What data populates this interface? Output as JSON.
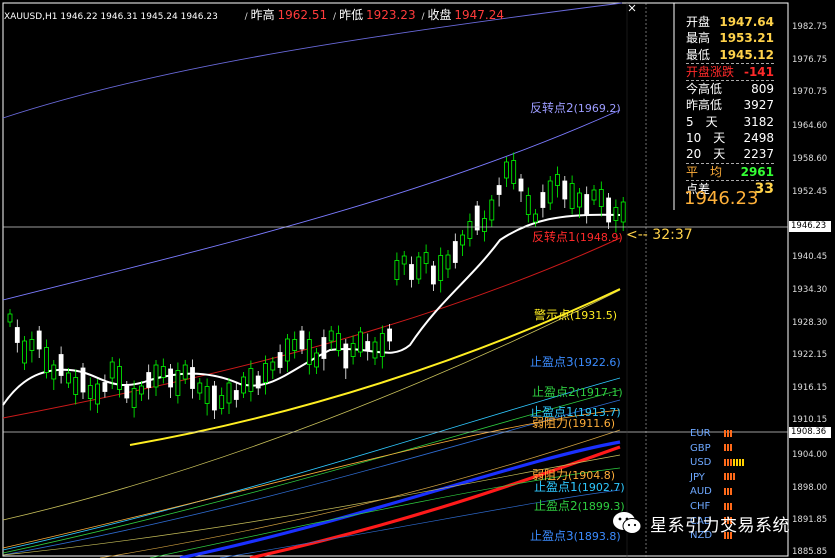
{
  "header": {
    "symbol": "XAUUSD,H1",
    "ohlc": "1946.22 1946.31 1945.24 1946.23",
    "prev_high_label": "昨高",
    "prev_high": "1962.51",
    "prev_low_label": "昨低",
    "prev_low": "1923.23",
    "close_label": "收盘",
    "close": "1947.24"
  },
  "panel": [
    {
      "k": "开盘",
      "v": "1947.64",
      "style": ""
    },
    {
      "k": "最高",
      "v": "1953.21",
      "style": ""
    },
    {
      "k": "最低",
      "v": "1945.12",
      "style": "ul"
    },
    {
      "k": "开盘涨跌",
      "v": "-141",
      "style": "red ul"
    },
    {
      "k": "今高低",
      "v": "809",
      "style": ""
    },
    {
      "k": "昨高低",
      "v": "3927",
      "style": ""
    },
    {
      "k": "5　天",
      "v": "3182",
      "style": ""
    },
    {
      "k": "10　天",
      "v": "2498",
      "style": ""
    },
    {
      "k": "20　天",
      "v": "2237",
      "style": "ul"
    },
    {
      "k": "平　均",
      "v": "2961",
      "style": "avg ul"
    },
    {
      "k": "点差",
      "v": "33",
      "style": "diff"
    }
  ],
  "current_price": "1946.23",
  "countdown": "<-- 32:37",
  "axis_ticks": [
    "1982.75",
    "1976.75",
    "1970.75",
    "1964.60",
    "1958.60",
    "1952.45",
    "1946.23",
    "1940.45",
    "1934.30",
    "1928.30",
    "1922.15",
    "1916.15",
    "1910.15",
    "1904.00",
    "1898.00",
    "1891.85",
    "1885.85"
  ],
  "axis_tags": [
    "1946.23",
    "1908.36"
  ],
  "levels": [
    {
      "name": "反转点2",
      "price": "(1969.2)",
      "color": "#9c9cff"
    },
    {
      "name": "反转点1",
      "price": "(1948.9)",
      "color": "#ff2a2a"
    },
    {
      "name": "警示点",
      "price": "(1931.5)",
      "color": "#ffee22"
    },
    {
      "name": "止盈点3",
      "price": "(1922.6)",
      "color": "#3b8cff"
    },
    {
      "name": "止盈点2",
      "price": "(1917.1)",
      "color": "#2ecc40"
    },
    {
      "name": "止盈点1",
      "price": "(1913.7)",
      "color": "#2ec8ff"
    },
    {
      "name": "弱阻力",
      "price": "(1911.6)",
      "color": "#ffae3a"
    },
    {
      "name": "弱阻力",
      "price": "(1904.8)",
      "color": "#ffae3a"
    },
    {
      "name": "止盈点1",
      "price": "(1902.7)",
      "color": "#2ec8ff"
    },
    {
      "name": "止盈点2",
      "price": "(1899.3)",
      "color": "#2ecc40"
    },
    {
      "name": "止盈点3",
      "price": "(1893.8)",
      "color": "#3b8cff"
    }
  ],
  "currencies": [
    {
      "c": "EUR",
      "bars": [
        "#ff6a1a",
        "#ff6a1a",
        "#ff6a1a"
      ]
    },
    {
      "c": "GBP",
      "bars": [
        "#ff6a1a",
        "#ff6a1a",
        "#ff6a1a"
      ]
    },
    {
      "c": "USD",
      "bars": [
        "#ff6a1a",
        "#ff6a1a",
        "#ff6a1a",
        "#ffd000",
        "#ffd000",
        "#ffd000",
        "#ffd000"
      ]
    },
    {
      "c": "JPY",
      "bars": [
        "#ff6a1a",
        "#ff6a1a",
        "#ff6a1a",
        "#ff6a1a"
      ]
    },
    {
      "c": "AUD",
      "bars": [
        "#ff6a1a",
        "#ff6a1a",
        "#ff6a1a"
      ]
    },
    {
      "c": "CHF",
      "bars": [
        "#ff6a1a",
        "#ff6a1a",
        "#ff6a1a"
      ]
    },
    {
      "c": "CAD",
      "bars": [
        "#ff6a1a",
        "#ff6a1a",
        "#ff6a1a"
      ]
    },
    {
      "c": "NZD",
      "bars": [
        "#ff6a1a",
        "#ff6a1a",
        "#ff6a1a"
      ]
    }
  ],
  "watermark": "星系引力交易系统",
  "colors": {
    "bull_candle": "#00ff00",
    "bear_candle": "#ffffff",
    "ma_white": "#ffffff",
    "ma_yellow": "#ffee22",
    "ma_red": "#ff2a2a",
    "ma_blue": "#7070ff"
  }
}
